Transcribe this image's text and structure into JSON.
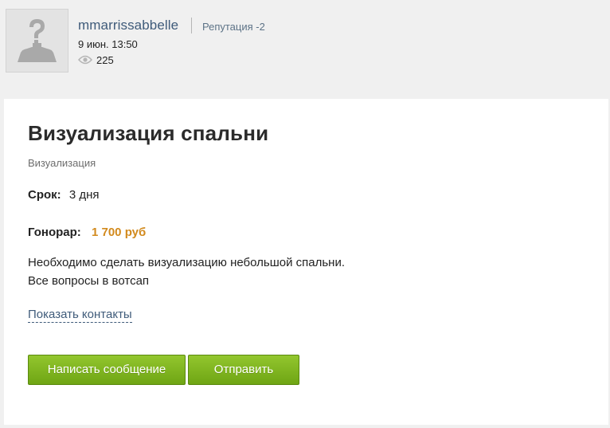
{
  "author": {
    "username": "mmarrissabbelle",
    "reputation": "Репутация -2",
    "date": "9 июн. 13:50",
    "views": "225",
    "avatar_icon": "default-user-silhouette-icon",
    "views_icon": "eye-icon"
  },
  "task": {
    "title": "Визуализация спальни",
    "category": "Визуализация",
    "term_label": "Срок:",
    "term_value": "3 дня",
    "fee_label": "Гонорар:",
    "fee_value": "1 700 руб",
    "description_line1": "Необходимо сделать визуализацию небольшой спальни.",
    "description_line2": "Все вопросы в вотсап",
    "show_contacts": "Показать контакты"
  },
  "actions": {
    "message_label": "Написать сообщение",
    "send_label": "Отправить"
  },
  "colors": {
    "page_background": "#f0f0f0",
    "card_background": "#ffffff",
    "link": "#3f5b7a",
    "fee": "#d28a1d",
    "button_green": "#7cb21e"
  }
}
